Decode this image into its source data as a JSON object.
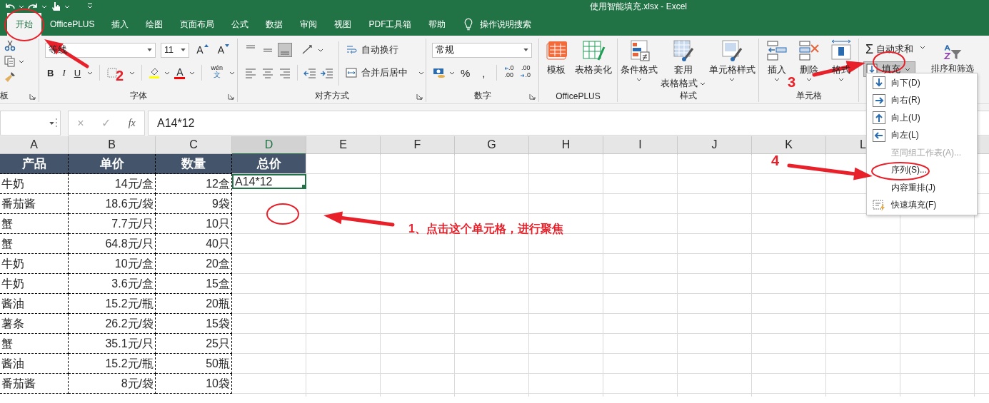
{
  "title_bar": {
    "title": "使用智能填充.xlsx  -  Excel"
  },
  "ribbon_tabs": [
    {
      "label": "开始",
      "selected": true
    },
    {
      "label": "OfficePLUS",
      "selected": false
    },
    {
      "label": "插入",
      "selected": false
    },
    {
      "label": "绘图",
      "selected": false
    },
    {
      "label": "页面布局",
      "selected": false
    },
    {
      "label": "公式",
      "selected": false
    },
    {
      "label": "数据",
      "selected": false
    },
    {
      "label": "审阅",
      "selected": false
    },
    {
      "label": "视图",
      "selected": false
    },
    {
      "label": "PDF工具箱",
      "selected": false
    },
    {
      "label": "帮助",
      "selected": false
    }
  ],
  "tell_me": {
    "label": "操作说明搜索"
  },
  "clipboard": {
    "group_label": "板"
  },
  "font": {
    "name": "等线",
    "size": "11",
    "grow": "A",
    "shrink": "A",
    "bold": "B",
    "italic": "I",
    "underline": "U",
    "font_color": "A",
    "phonetic_top": "wén",
    "phonetic_bottom": "文",
    "group_label": "字体"
  },
  "alignment": {
    "wrap_text": "自动换行",
    "merge_center": "合并后居中",
    "group_label": "对齐方式"
  },
  "number": {
    "format": "常规",
    "percent": "%",
    "comma": ",",
    "increase_decimal": {
      "top": ".0",
      "bottom": ".00"
    },
    "decrease_decimal": {
      "top": ".00",
      "bottom": ".0"
    },
    "group_label": "数字"
  },
  "officeplus": {
    "template": "模板",
    "beautify": "表格美化",
    "group_label": "OfficePLUS"
  },
  "styles": {
    "conditional": "条件格式",
    "table_format_top": "套用",
    "table_format_bottom": "表格格式",
    "cell_styles": "单元格样式",
    "group_label": "样式"
  },
  "cells": {
    "insert": "插入",
    "delete": "删除",
    "format": "格式",
    "group_label": "单元格"
  },
  "editing": {
    "sigma": "Σ",
    "autosum": "自动求和",
    "fill": {
      "label": "填充",
      "expanded": true
    },
    "sort_filter": "排序和筛选"
  },
  "formula_bar": {
    "cancel": "×",
    "enter": "✓",
    "function": "fx",
    "value": "A14*12"
  },
  "sheet": {
    "columns": [
      {
        "letter": "A",
        "selected": false
      },
      {
        "letter": "B",
        "selected": false
      },
      {
        "letter": "C",
        "selected": false
      },
      {
        "letter": "D",
        "selected": true
      },
      {
        "letter": "E",
        "selected": false
      },
      {
        "letter": "F",
        "selected": false
      },
      {
        "letter": "G",
        "selected": false
      },
      {
        "letter": "H",
        "selected": false
      },
      {
        "letter": "I",
        "selected": false
      },
      {
        "letter": "J",
        "selected": false
      },
      {
        "letter": "K",
        "selected": false
      },
      {
        "letter": "L",
        "selected": false
      }
    ],
    "header": [
      "产品",
      "单价",
      "数量",
      "总价"
    ],
    "rows": [
      {
        "product": "牛奶",
        "price": "14元/盒",
        "quantity": "12盒",
        "total": "A14*12",
        "total_selected": true
      },
      {
        "product": "番茄酱",
        "price": "18.6元/袋",
        "quantity": "9袋"
      },
      {
        "product": "蟹",
        "price": "7.7元/只",
        "quantity": "10只"
      },
      {
        "product": "蟹",
        "price": "64.8元/只",
        "quantity": "40只"
      },
      {
        "product": "牛奶",
        "price": "10元/盒",
        "quantity": "20盒"
      },
      {
        "product": "牛奶",
        "price": "3.6元/盒",
        "quantity": "15盒"
      },
      {
        "product": "酱油",
        "price": "15.2元/瓶",
        "quantity": "20瓶"
      },
      {
        "product": "薯条",
        "price": "26.2元/袋",
        "quantity": "15袋"
      },
      {
        "product": "蟹",
        "price": "35.1元/只",
        "quantity": "25只"
      },
      {
        "product": "酱油",
        "price": "15.2元/瓶",
        "quantity": "50瓶"
      },
      {
        "product": "番茄酱",
        "price": "8元/袋",
        "quantity": "10袋"
      }
    ]
  },
  "fill_menu": {
    "items": [
      {
        "label": "向下(D)",
        "kind": "down",
        "disabled": false
      },
      {
        "label": "向右(R)",
        "kind": "right",
        "disabled": false
      },
      {
        "label": "向上(U)",
        "kind": "up",
        "disabled": false
      },
      {
        "label": "向左(L)",
        "kind": "left",
        "disabled": false
      },
      {
        "label": "至同组工作表(A)...",
        "kind": "plain",
        "disabled": true
      },
      {
        "label": "序列(S)...",
        "kind": "plain",
        "disabled": false
      },
      {
        "label": "内容重排(J)",
        "kind": "plain",
        "disabled": false
      },
      {
        "label": "快速填充(F)",
        "kind": "flash",
        "disabled": false
      }
    ]
  },
  "annotations": {
    "step_1": "1、点击这个单元格，进行聚焦",
    "step_2": "2",
    "step_3": "3",
    "step_4": "4"
  }
}
